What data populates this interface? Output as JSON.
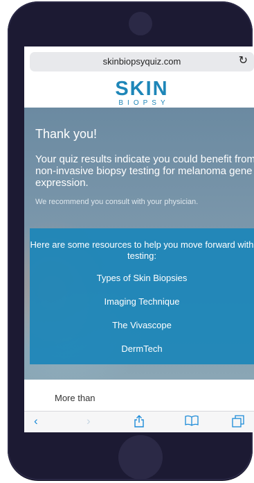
{
  "browser": {
    "url": "skinbiopsyquiz.com",
    "reload_icon": "reload-icon"
  },
  "logo": {
    "main": "SKIN",
    "sub": "BIOPSY",
    "color": "#1e86b8"
  },
  "hero": {
    "title": "Thank you!",
    "results": "Your quiz results indicate you could benefit from non-invasive biopsy testing for melanoma gene expression.",
    "recommend": "We recommend you consult with your physician."
  },
  "resources": {
    "intro": "Here are some resources to help you move forward with testing:",
    "links": [
      "Types of Skin Biopsies",
      "Imaging Technique",
      "The Vivascope",
      "DermTech"
    ],
    "background": "#1b86b8"
  },
  "below_fold": {
    "text": "More than"
  },
  "toolbar": {
    "back_icon": "back-icon",
    "forward_icon": "forward-icon",
    "share_icon": "share-icon",
    "bookmarks_icon": "bookmarks-icon",
    "tabs_icon": "tabs-icon",
    "accent": "#1a8ad8"
  }
}
